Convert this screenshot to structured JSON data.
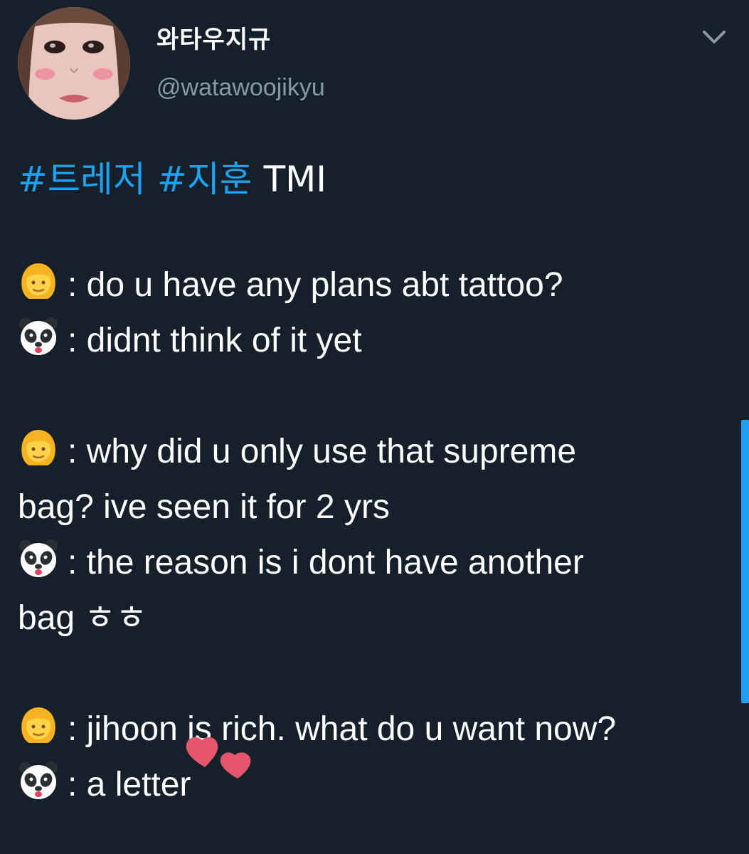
{
  "author": {
    "display_name": "와타우지규",
    "handle": "@watawoojikyu",
    "avatar_icon": "profile-photo",
    "menu_icon": "chevron-down-icon"
  },
  "tweet": {
    "hashtag_1": "#트레저",
    "hashtag_2": "#지훈",
    "tag_suffix": "TMI",
    "lines": [
      {
        "speaker": "girl-emoji",
        "text": ": do u have any plans abt tattoo?"
      },
      {
        "speaker": "panda-emoji",
        "text": ": didnt think of it yet"
      },
      {
        "speaker": "girl-emoji",
        "text": ": why did u only use that supreme"
      },
      {
        "speaker": "",
        "text": "bag? ive seen it for 2 yrs"
      },
      {
        "speaker": "panda-emoji",
        "text": ": the reason is i dont have another"
      },
      {
        "speaker": "",
        "text": "bag ㅎㅎ"
      },
      {
        "speaker": "girl-emoji",
        "text": ": jihoon is rich. what do u want now?"
      },
      {
        "speaker": "panda-emoji",
        "text": ": a letter"
      }
    ],
    "hearts_icon": "two-hearts-icon"
  },
  "colors": {
    "background": "#15202b",
    "text": "#ffffff",
    "secondary": "#8899a6",
    "link": "#1da1f2",
    "heart": "#e5566d"
  }
}
